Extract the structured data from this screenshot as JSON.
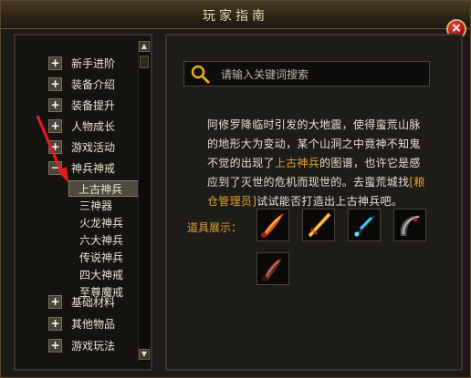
{
  "window": {
    "title": "玩家指南",
    "close_label": "×"
  },
  "sidebar": {
    "items": [
      {
        "label": "新手进阶",
        "toggle": "+"
      },
      {
        "label": "装备介绍",
        "toggle": "+"
      },
      {
        "label": "装备提升",
        "toggle": "+"
      },
      {
        "label": "人物成长",
        "toggle": "+"
      },
      {
        "label": "游戏活动",
        "toggle": "+"
      },
      {
        "label": "神兵神戒",
        "toggle": "−"
      },
      {
        "label": "基础材料",
        "toggle": "+"
      },
      {
        "label": "其他物品",
        "toggle": "+"
      },
      {
        "label": "游戏玩法",
        "toggle": "+"
      }
    ],
    "children": [
      "上古神兵",
      "三神器",
      "火龙神兵",
      "六大神兵",
      "传说神兵",
      "四大神戒",
      "至尊魔戒"
    ],
    "selected_child": "上古神兵",
    "scroll_up": "▲",
    "scroll_down": "▼"
  },
  "search": {
    "placeholder": "请输入关键词搜索"
  },
  "content": {
    "desc_part1": "阿修罗降临时引发的大地震，使得蛮荒山脉的地形大为变动，某个山洞之中竟神不知鬼不觉的出现了",
    "desc_highlight1": "上古神兵",
    "desc_part2": "的图谱，也许它是感应到了灭世的危机而现世的。去蛮荒城找",
    "desc_highlight2": "[粮仓管理员]",
    "desc_part3": "试试能否打造出上古神兵吧。",
    "items_label": "道具展示：",
    "item_icons": [
      "flame-blade-icon",
      "golden-sword-icon",
      "blue-dagger-icon",
      "dark-scythe-icon",
      "bone-blade-icon"
    ]
  },
  "colors": {
    "accent": "#e0a030",
    "arrow": "#e02020",
    "text": "#eae4d6"
  }
}
